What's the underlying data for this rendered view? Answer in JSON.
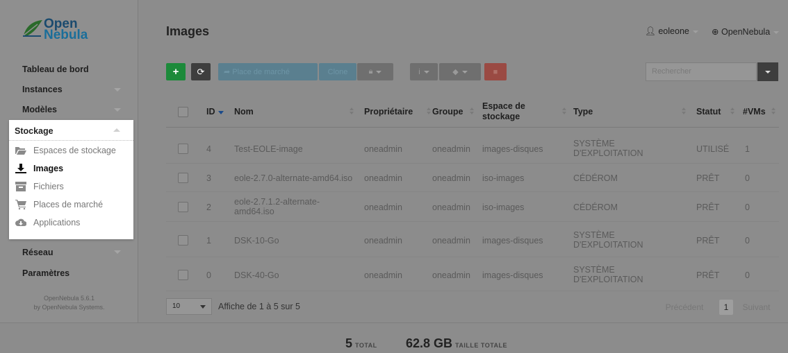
{
  "brand": {
    "line1": "Open",
    "line2": "Nebula"
  },
  "sidebar": {
    "items": [
      {
        "label": "Tableau de bord"
      },
      {
        "label": "Instances"
      },
      {
        "label": "Modèles"
      },
      {
        "label": "Stockage"
      },
      {
        "label": "Réseau"
      },
      {
        "label": "Paramètres"
      }
    ],
    "stockage_sub": [
      {
        "label": "Espaces de stockage",
        "icon": "folder-open-icon"
      },
      {
        "label": "Images",
        "icon": "download-icon"
      },
      {
        "label": "Fichiers",
        "icon": "archive-icon"
      },
      {
        "label": "Places de marché",
        "icon": "cart-icon"
      },
      {
        "label": "Applications",
        "icon": "cloud-download-icon"
      }
    ],
    "version_line1": "OpenNebula 5.6.1",
    "version_line2": "by OpenNebula Systems."
  },
  "header": {
    "title": "Images",
    "user": "eoleone",
    "zone": "OpenNebula"
  },
  "toolbar": {
    "add": "+",
    "refresh": "⟳",
    "market": "Place de marché",
    "clone": "Clone",
    "search_placeholder": "Rechercher"
  },
  "table": {
    "columns": [
      "ID",
      "Nom",
      "Propriétaire",
      "Groupe",
      "Espace de stockage",
      "Type",
      "Statut",
      "#VMs"
    ],
    "rows": [
      {
        "id": "4",
        "name": "Test-EOLE-image",
        "owner": "oneadmin",
        "group": "oneadmin",
        "ds": "images-disques",
        "type": "SYSTÈME D'EXPLOITATION",
        "status": "UTILISÉ",
        "vms": "1"
      },
      {
        "id": "3",
        "name": "eole-2.7.0-alternate-amd64.iso",
        "owner": "oneadmin",
        "group": "oneadmin",
        "ds": "iso-images",
        "type": "CÉDÉROM",
        "status": "PRÊT",
        "vms": "0"
      },
      {
        "id": "2",
        "name": "eole-2.7.1.2-alternate-amd64.iso",
        "owner": "oneadmin",
        "group": "oneadmin",
        "ds": "iso-images",
        "type": "CÉDÉROM",
        "status": "PRÊT",
        "vms": "0"
      },
      {
        "id": "1",
        "name": "DSK-10-Go",
        "owner": "oneadmin",
        "group": "oneadmin",
        "ds": "images-disques",
        "type": "SYSTÈME D'EXPLOITATION",
        "status": "PRÊT",
        "vms": "0"
      },
      {
        "id": "0",
        "name": "DSK-40-Go",
        "owner": "oneadmin",
        "group": "oneadmin",
        "ds": "images-disques",
        "type": "SYSTÈME D'EXPLOITATION",
        "status": "PRÊT",
        "vms": "0"
      }
    ]
  },
  "pager": {
    "page_size": "10",
    "info": "Affiche de 1 à 5 sur 5",
    "prev": "Précédent",
    "current": "1",
    "next": "Suivant"
  },
  "totals": {
    "count": "5",
    "count_label": "TOTAL",
    "size": "62.8 GB",
    "size_label": "TAILLE TOTALE"
  }
}
